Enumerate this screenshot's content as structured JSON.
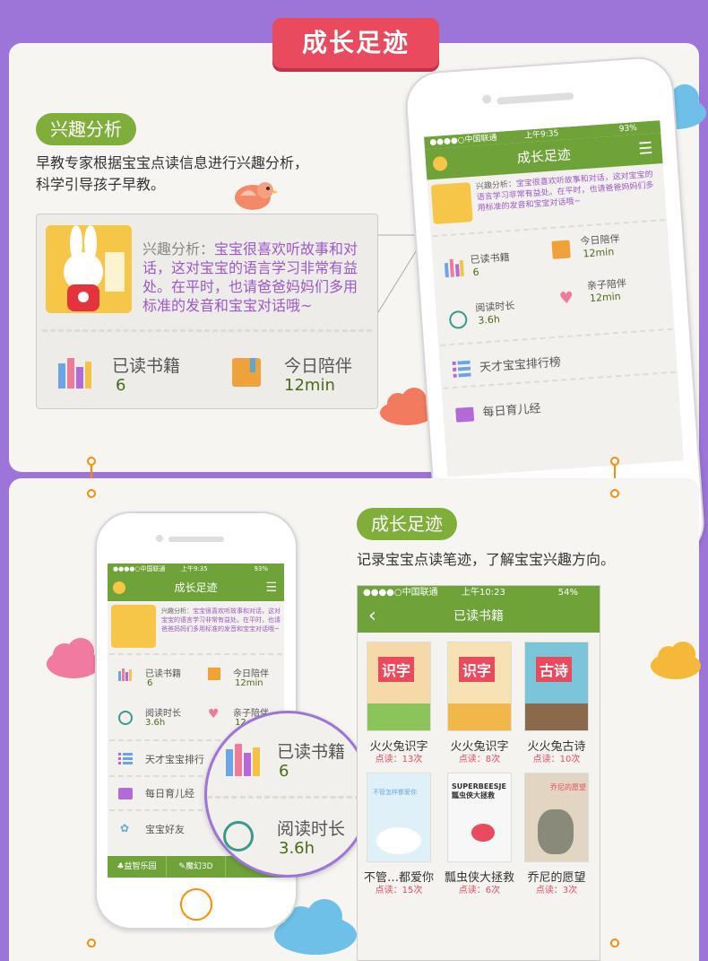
{
  "banner": {
    "title": "成长足迹"
  },
  "section1": {
    "pill": "兴趣分析",
    "desc_line1": "早教专家根据宝宝点读信息进行兴趣分析，",
    "desc_line2": "科学引导孩子早教。",
    "card": {
      "analysis_label": "兴趣分析：",
      "analysis_text1": "宝宝很喜欢听故事和对",
      "analysis_text2": "话，这对宝宝的语言学习非常有益",
      "analysis_text3": "处。在平时，也请爸爸妈妈们多用",
      "analysis_text4": "标准的发音和宝宝对话哦~",
      "books_label": "已读书籍",
      "books_value": "6",
      "today_label": "今日陪伴",
      "today_value": "12min"
    }
  },
  "phone1": {
    "carrier": "●●●●○中国联通",
    "time": "上午9:35",
    "battery": "93%",
    "nav_title": "成长足迹",
    "analysis_label": "兴趣分析：",
    "analysis_text": "宝宝很喜欢听故事和对话，这对宝宝的语言学习非常有益处。在平时，也请爸爸妈妈们多用标准的发音和宝宝对话哦~",
    "books_label": "已读书籍",
    "books_value": "6",
    "today_label": "今日陪伴",
    "today_value": "12min",
    "read_label": "阅读时长",
    "read_value": "3.6h",
    "parent_label": "亲子陪伴",
    "parent_value": "12min",
    "rank_label": "天才宝宝排行榜",
    "daily_label": "每日育儿经"
  },
  "section2": {
    "pill": "成长足迹",
    "desc": "记录宝宝点读笔迹，了解宝宝兴趣方向。"
  },
  "phone2": {
    "carrier": "●●●●○中国联通",
    "time": "上午9:35",
    "battery": "93%",
    "nav_title": "成长足迹",
    "analysis_label": "兴趣分析：",
    "analysis_text": "宝宝很喜欢听故事和对话，这对宝宝的语言学习非常有益处。在平时，也请爸爸妈妈们多用标准的发音和宝宝对话哦~",
    "books_label": "已读书籍",
    "books_value": "6",
    "today_label": "今日陪伴",
    "today_value": "12min",
    "read_label": "阅读时长",
    "read_value": "3.6h",
    "parent_label": "亲子陪伴",
    "parent_value": "12",
    "rank_label": "天才宝宝排行",
    "daily_label": "每日育儿经",
    "friends_label": "宝宝好友",
    "tab1": "益智乐园",
    "tab2": "魔幻3D"
  },
  "magnifier": {
    "books_label": "已读书籍",
    "books_value": "6",
    "read_label": "阅读时长",
    "read_value": "3.6h"
  },
  "screen3": {
    "carrier": "●●●●○中国联通",
    "time": "上午10:23",
    "battery": "54%",
    "nav_title": "已读书籍",
    "cover_labels": [
      "识字",
      "识字",
      "古诗",
      "不管怎样都爱你",
      "SUPERBEESJE 瓢虫侠大拯救",
      "乔尼的愿望"
    ],
    "books": [
      {
        "title": "火火兔识字",
        "count": "点读：13次"
      },
      {
        "title": "火火兔识字",
        "count": "点读：8次"
      },
      {
        "title": "火火兔古诗",
        "count": "点读：10次"
      },
      {
        "title": "不管…都爱你",
        "count": "点读：15次"
      },
      {
        "title": "瓢虫侠大拯救",
        "count": "点读：6次"
      },
      {
        "title": "乔尼的愿望",
        "count": "点读：3次"
      }
    ]
  },
  "colors": {
    "purple": "#9d74d8",
    "green": "#7fae3a",
    "red": "#e94a5e",
    "text_purple": "#9b59c9"
  }
}
